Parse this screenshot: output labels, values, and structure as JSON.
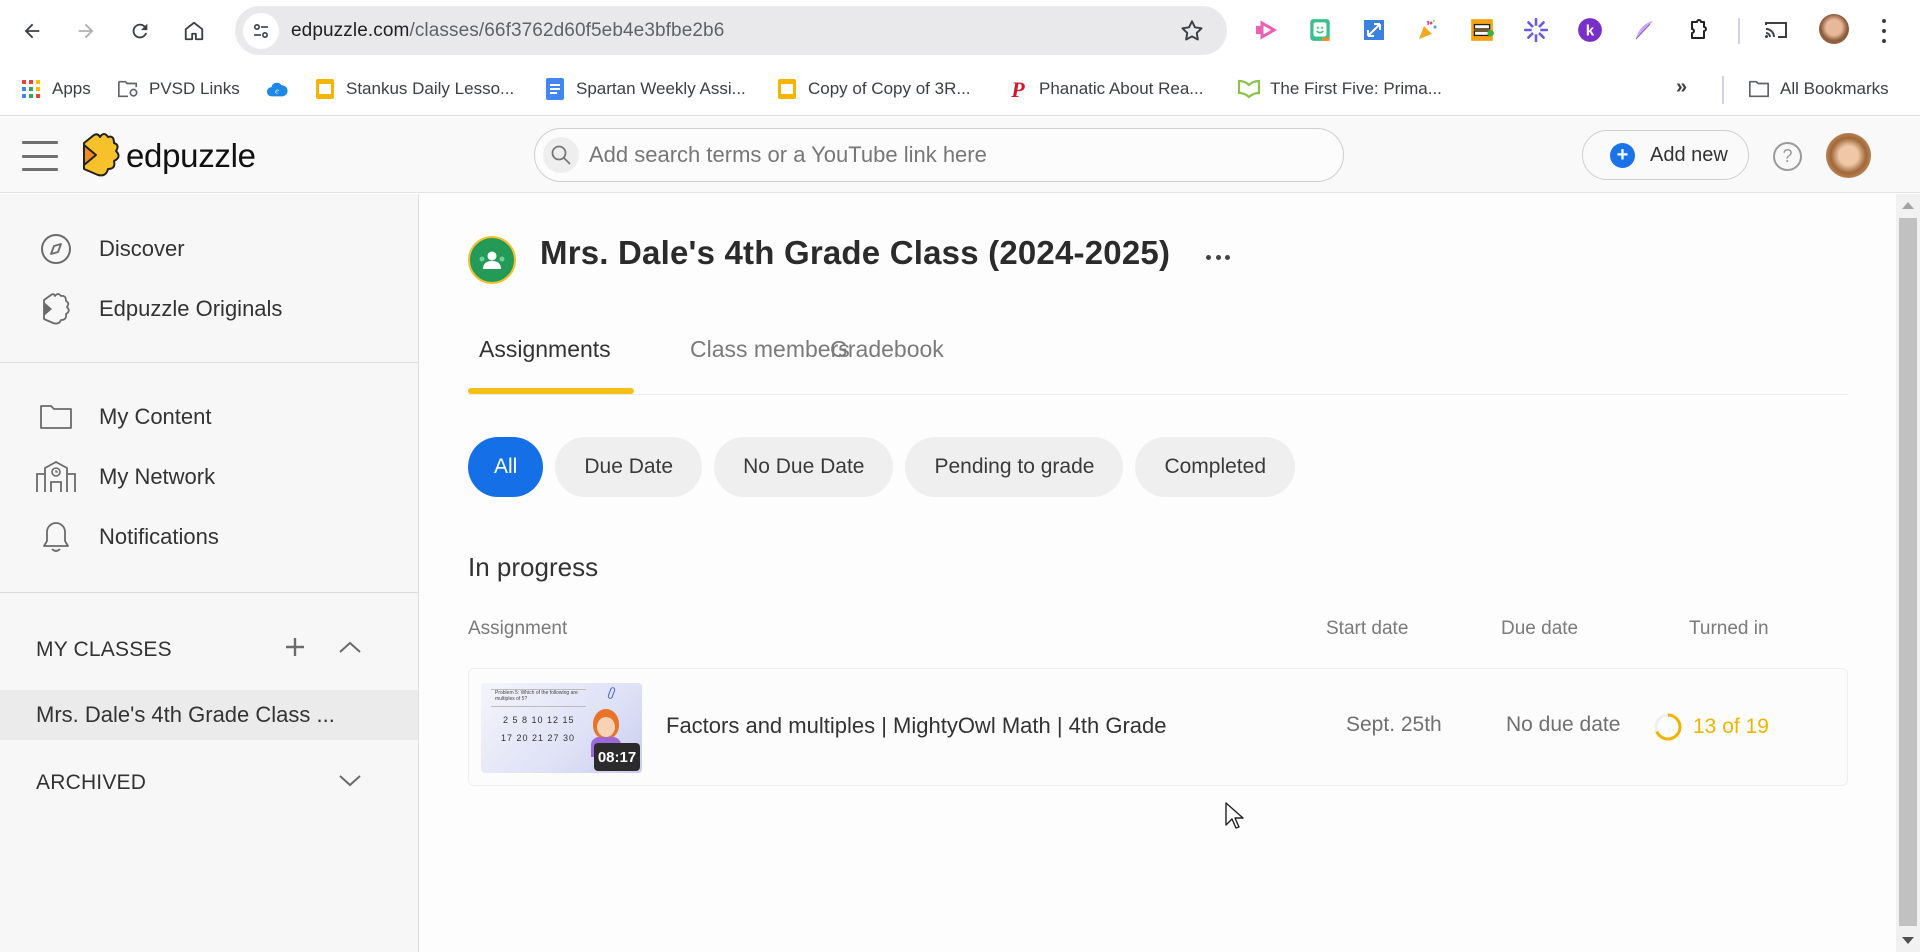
{
  "browser": {
    "url_host": "edpuzzle.com",
    "url_path": "/classes/66f3762d60f5eb4e3bfbe2b6",
    "extensions": [
      "pink-arrow-extension",
      "green-smiley-extension",
      "blue-resize-extension",
      "party-popper-extension",
      "orange-bar-extension",
      "purple-asterisk-extension",
      "k-circle-extension",
      "feather-extension",
      "puzzle-extensions-menu"
    ],
    "bookmarks": [
      {
        "label": "Apps",
        "icon": "apps-grid-icon"
      },
      {
        "label": "PVSD Links",
        "icon": "folder-gear-icon"
      },
      {
        "label": "",
        "icon": "cloud-e-icon"
      },
      {
        "label": "Stankus Daily Lesso...",
        "icon": "slides-icon"
      },
      {
        "label": "Spartan Weekly Assi...",
        "icon": "docs-icon"
      },
      {
        "label": "Copy of Copy of 3R...",
        "icon": "slides-icon"
      },
      {
        "label": "Phanatic About Rea...",
        "icon": "phillies-p-icon"
      },
      {
        "label": "The First Five: Prima...",
        "icon": "open-book-icon"
      }
    ],
    "more_bookmarks": "»",
    "all_bookmarks": "All Bookmarks"
  },
  "header": {
    "logo_text": "edpuzzle",
    "search_placeholder": "Add search terms or a YouTube link here",
    "search_value": "",
    "add_new_label": "Add new",
    "help_label": "?"
  },
  "sidebar": {
    "primary": [
      {
        "label": "Discover",
        "icon": "compass-icon"
      },
      {
        "label": "Edpuzzle Originals",
        "icon": "edpuzzle-puzzle-icon"
      }
    ],
    "secondary": [
      {
        "label": "My Content",
        "icon": "folder-icon"
      },
      {
        "label": "My Network",
        "icon": "school-building-icon"
      },
      {
        "label": "Notifications",
        "icon": "bell-icon"
      }
    ],
    "my_classes_heading": "MY CLASSES",
    "classes": [
      {
        "label": "Mrs. Dale's 4th Grade Class ...",
        "selected": true
      }
    ],
    "archived_heading": "ARCHIVED"
  },
  "main": {
    "class_title": "Mrs. Dale's 4th Grade Class (2024-2025)",
    "tabs": [
      {
        "label": "Assignments",
        "active": true
      },
      {
        "label": "Class members",
        "active": false
      },
      {
        "label": "Gradebook",
        "active": false
      }
    ],
    "filters": [
      {
        "label": "All",
        "active": true
      },
      {
        "label": "Due Date",
        "active": false
      },
      {
        "label": "No Due Date",
        "active": false
      },
      {
        "label": "Pending to grade",
        "active": false
      },
      {
        "label": "Completed",
        "active": false
      }
    ],
    "section_title": "In progress",
    "columns": {
      "assignment": "Assignment",
      "start_date": "Start date",
      "due_date": "Due date",
      "turned_in": "Turned in"
    },
    "assignments": [
      {
        "title": "Factors and multiples | MightyOwl Math | 4th Grade",
        "duration": "08:17",
        "thumbnail_question": "Problem 5: Which of the following are multiples of 5?",
        "thumbnail_row1": "2 5 8 10 12 15",
        "thumbnail_row2": "17 20 21 27 30",
        "start_date": "Sept. 25th",
        "due_date": "No due date",
        "turned_in_text": "13 of 19",
        "turned_in_count": 13,
        "turned_in_total": 19
      }
    ]
  },
  "colors": {
    "accent_blue": "#1570e8",
    "tab_indicator_yellow": "#f5bf16",
    "progress_yellow": "#f0b400",
    "classroom_green": "#239b56"
  }
}
